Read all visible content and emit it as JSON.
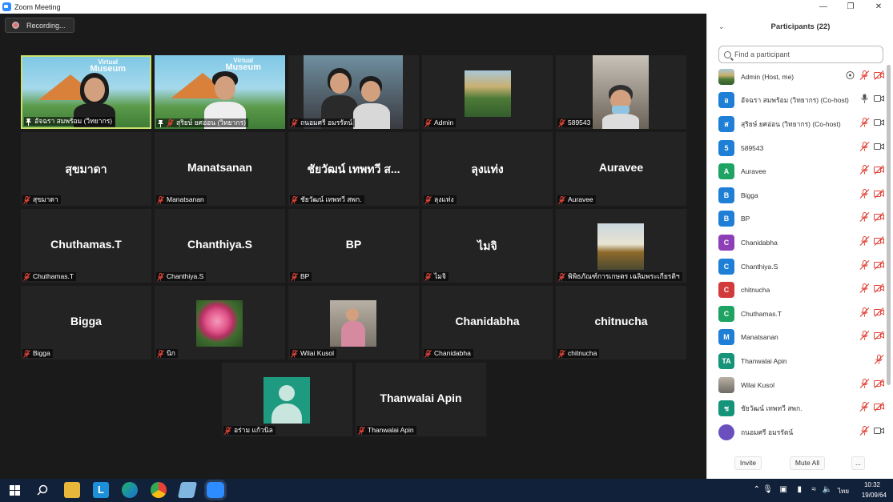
{
  "window": {
    "title": "Zoom Meeting"
  },
  "recording": {
    "label": "Recording..."
  },
  "tiles": [
    {
      "id": "t1",
      "name": "อัจฉรา สมพร้อม (วิทยากร)",
      "big": "",
      "muted": false,
      "pinned": true
    },
    {
      "id": "t2",
      "name": "สุริยษ์ ยศอ่อน (วิทยากร)",
      "big": "",
      "muted": true,
      "pinned": true
    },
    {
      "id": "t3",
      "name": "ถนอมศรี อมรรัตน์",
      "big": "",
      "muted": true
    },
    {
      "id": "t4",
      "name": "Admin",
      "big": "",
      "muted": true
    },
    {
      "id": "t5",
      "name": "589543",
      "big": "",
      "muted": true
    },
    {
      "id": "t6",
      "name": "สุขมาดา",
      "big": "สุขมาดา",
      "muted": true
    },
    {
      "id": "t7",
      "name": "Manatsanan",
      "big": "Manatsanan",
      "muted": true
    },
    {
      "id": "t8",
      "name": "ชัยวัฒน์ เทพทวี สพก.",
      "big": "ชัยวัฒน์ เทพทวี ส...",
      "muted": true
    },
    {
      "id": "t9",
      "name": "ลุงแท่ง",
      "big": "ลุงแท่ง",
      "muted": true
    },
    {
      "id": "t10",
      "name": "Auravee",
      "big": "Auravee",
      "muted": true
    },
    {
      "id": "t11",
      "name": "Chuthamas.T",
      "big": "Chuthamas.T",
      "muted": true
    },
    {
      "id": "t12",
      "name": "Chanthiya.S",
      "big": "Chanthiya.S",
      "muted": true
    },
    {
      "id": "t13",
      "name": "BP",
      "big": "BP",
      "muted": true
    },
    {
      "id": "t14",
      "name": "ไมจิ",
      "big": "ไมจิ",
      "muted": true
    },
    {
      "id": "t15",
      "name": "พิพิธภัณฑ์การเกษตร เฉลิมพระเกียรติฯ",
      "big": "",
      "muted": true
    },
    {
      "id": "t16",
      "name": "Bigga",
      "big": "Bigga",
      "muted": true
    },
    {
      "id": "t17",
      "name": "นิก",
      "big": "",
      "muted": true
    },
    {
      "id": "t18",
      "name": "Wilai Kusol",
      "big": "",
      "muted": true
    },
    {
      "id": "t19",
      "name": "Chanidabha",
      "big": "Chanidabha",
      "muted": true
    },
    {
      "id": "t20",
      "name": "chitnucha",
      "big": "chitnucha",
      "muted": true
    },
    {
      "id": "t21",
      "name": "อร่าม แก้วนิล",
      "big": "",
      "muted": true
    },
    {
      "id": "t22",
      "name": "Thanwalai Apin",
      "big": "Thanwalai Apin",
      "muted": true
    }
  ],
  "panel": {
    "title": "Participants (22)",
    "search_placeholder": "Find a participant",
    "participants": [
      {
        "name": "Admin (Host, me)",
        "initial": "",
        "color": "#6b8f3a",
        "mic": "muted",
        "video": "off",
        "extra": "share"
      },
      {
        "name": "อัจฉรา สมพร้อม (วิทยากร) (Co-host)",
        "initial": "อ",
        "color": "#1f7fd6",
        "mic": "on",
        "video": "on-outline"
      },
      {
        "name": "สุริยษ์ ยศอ่อน (วิทยากร) (Co-host)",
        "initial": "ส",
        "color": "#1f7fd6",
        "mic": "muted",
        "video": "on-outline"
      },
      {
        "name": "589543",
        "initial": "5",
        "color": "#1f7fd6",
        "mic": "muted",
        "video": "on-outline"
      },
      {
        "name": "Auravee",
        "initial": "A",
        "color": "#1ea362",
        "mic": "muted",
        "video": "off"
      },
      {
        "name": "Bigga",
        "initial": "B",
        "color": "#1f7fd6",
        "mic": "muted",
        "video": "off"
      },
      {
        "name": "BP",
        "initial": "B",
        "color": "#1f7fd6",
        "mic": "muted",
        "video": "off"
      },
      {
        "name": "Chanidabha",
        "initial": "C",
        "color": "#8e3fb8",
        "mic": "muted",
        "video": "off"
      },
      {
        "name": "Chanthiya.S",
        "initial": "C",
        "color": "#1f7fd6",
        "mic": "muted",
        "video": "off"
      },
      {
        "name": "chitnucha",
        "initial": "C",
        "color": "#d23b3b",
        "mic": "muted",
        "video": "off"
      },
      {
        "name": "Chuthamas.T",
        "initial": "C",
        "color": "#1ea362",
        "mic": "muted",
        "video": "off"
      },
      {
        "name": "Manatsanan",
        "initial": "M",
        "color": "#1f7fd6",
        "mic": "muted",
        "video": "off"
      },
      {
        "name": "Thanwalai Apin",
        "initial": "TA",
        "color": "#16947a",
        "mic": "muted",
        "video": "none"
      },
      {
        "name": "Wilai Kusol",
        "initial": "",
        "color": "#8a8a9a",
        "mic": "muted",
        "video": "off"
      },
      {
        "name": "ชัยวัฒน์ เทพทวี สพก.",
        "initial": "ช",
        "color": "#16947a",
        "mic": "muted",
        "video": "off"
      },
      {
        "name": "ถนอมศรี อมรรัตน์",
        "initial": "",
        "color": "#6a4fbf",
        "mic": "muted",
        "video": "on-outline"
      }
    ],
    "invite_label": "Invite",
    "mute_all_label": "Mute All",
    "more_label": "..."
  },
  "taskbar": {
    "time": "10:32",
    "date": "19/09/64",
    "lang": "ไทย"
  },
  "colors": {
    "accent": "#2d8cff",
    "active_speaker": "#c8e26b",
    "muted_red": "#e0453a"
  }
}
